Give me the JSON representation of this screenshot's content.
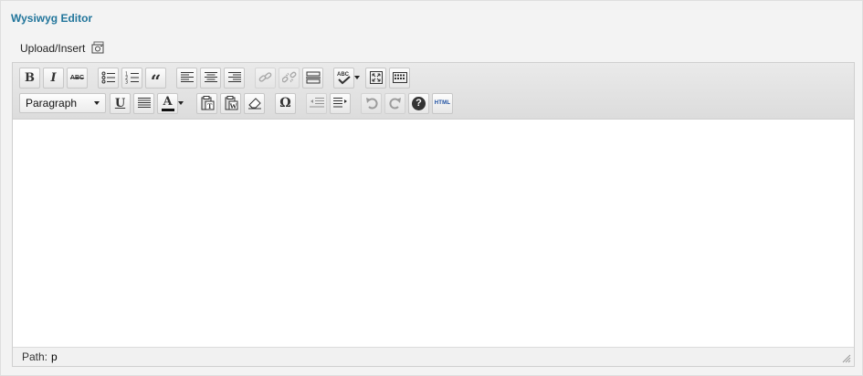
{
  "panel": {
    "title": "Wysiwyg Editor"
  },
  "upload": {
    "label": "Upload/Insert",
    "icon": "media-upload-icon"
  },
  "toolbar": {
    "row1": [
      {
        "name": "bold",
        "glyph": "B"
      },
      {
        "name": "italic",
        "glyph": "I"
      },
      {
        "name": "strikethrough",
        "glyph": "ABC"
      },
      {
        "name": "bullet-list"
      },
      {
        "name": "numbered-list"
      },
      {
        "name": "blockquote",
        "glyph": "“"
      },
      {
        "name": "align-left"
      },
      {
        "name": "align-center"
      },
      {
        "name": "align-right"
      },
      {
        "name": "insert-link"
      },
      {
        "name": "remove-link"
      },
      {
        "name": "insert-more"
      },
      {
        "name": "spellcheck",
        "glyph": "ABC"
      },
      {
        "name": "fullscreen"
      },
      {
        "name": "kitchen-sink"
      }
    ],
    "format_select": "Paragraph",
    "row2": [
      {
        "name": "underline",
        "glyph": "U"
      },
      {
        "name": "justify"
      },
      {
        "name": "text-color",
        "glyph": "A"
      },
      {
        "name": "paste-text",
        "glyph": "T"
      },
      {
        "name": "paste-word",
        "glyph": "W"
      },
      {
        "name": "clear-formatting"
      },
      {
        "name": "special-character",
        "glyph": "Ω"
      },
      {
        "name": "outdent"
      },
      {
        "name": "indent"
      },
      {
        "name": "undo"
      },
      {
        "name": "redo"
      },
      {
        "name": "help",
        "glyph": "?"
      },
      {
        "name": "html-source",
        "glyph": "HTML"
      }
    ]
  },
  "status": {
    "path_label": "Path:",
    "path_value": "p"
  },
  "colors": {
    "title": "#21759b",
    "toolbar_bg": "#e2e2e2",
    "text_color_bar": "#111111"
  }
}
